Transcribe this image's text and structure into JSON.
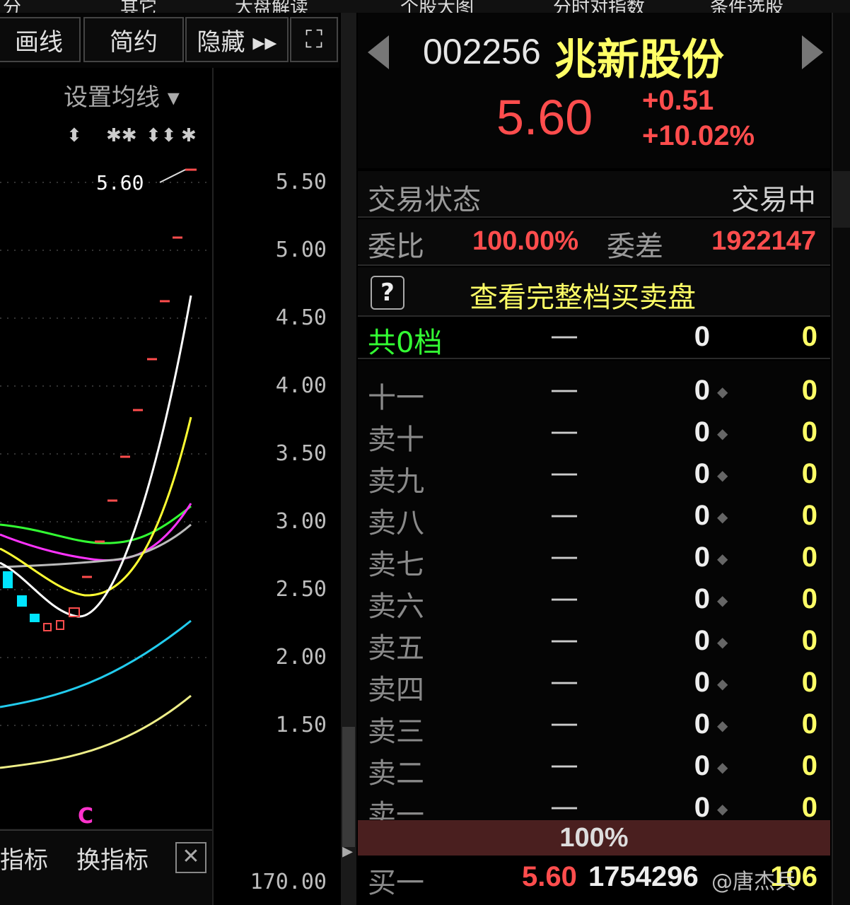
{
  "top_menu": [
    "分",
    "其它",
    "大盘解读",
    "个股大图",
    "分时对指数",
    "条件选股"
  ],
  "toolbar": {
    "draw_line": "画线",
    "simple": "简约",
    "hide": "隐藏 ▸▸",
    "fullscreen_icon": "⛶"
  },
  "chart": {
    "ma_setting": "设置均线 ▾",
    "price_marker": "5.60",
    "marker_c": "C",
    "axis_labels": [
      "5.50",
      "5.00",
      "4.50",
      "4.00",
      "3.50",
      "3.00",
      "2.50",
      "2.00",
      "1.50"
    ],
    "volume_axis_label": "170.00",
    "colors": {
      "up": "#ff4d4d",
      "down": "#00e5ff",
      "ma_white": "#ffffff",
      "ma_yellow": "#ffff33",
      "ma_magenta": "#ff33ff",
      "ma_green": "#33ff33",
      "ma_gray": "#bbbbbb",
      "ma_cyan": "#22ccee",
      "ma_pale_yellow": "#eeee88"
    }
  },
  "bottom_tabs": {
    "tab1": "指标",
    "tab2": "换指标",
    "close": "✕"
  },
  "quote": {
    "code": "002256",
    "name": "兆新股份",
    "price": "5.60",
    "change": "+0.51",
    "change_pct": "+10.02%"
  },
  "status": {
    "label": "交易状态",
    "value": "交易中"
  },
  "ratio": {
    "label": "委比",
    "value": "100.00%",
    "diff_label": "委差",
    "diff_value": "1922147"
  },
  "full_book": {
    "help": "?",
    "link": "查看完整档买卖盘"
  },
  "summary": {
    "label": "共0档",
    "dash": "—",
    "a": "0",
    "b": "0"
  },
  "levels": [
    {
      "name": "十一",
      "dash": "—",
      "a": "0",
      "b": "0"
    },
    {
      "name": "卖十",
      "dash": "—",
      "a": "0",
      "b": "0"
    },
    {
      "name": "卖九",
      "dash": "—",
      "a": "0",
      "b": "0"
    },
    {
      "name": "卖八",
      "dash": "—",
      "a": "0",
      "b": "0"
    },
    {
      "name": "卖七",
      "dash": "—",
      "a": "0",
      "b": "0"
    },
    {
      "name": "卖六",
      "dash": "—",
      "a": "0",
      "b": "0"
    },
    {
      "name": "卖五",
      "dash": "—",
      "a": "0",
      "b": "0"
    },
    {
      "name": "卖四",
      "dash": "—",
      "a": "0",
      "b": "0"
    },
    {
      "name": "卖三",
      "dash": "—",
      "a": "0",
      "b": "0"
    },
    {
      "name": "卖二",
      "dash": "—",
      "a": "0",
      "b": "0"
    },
    {
      "name": "卖一",
      "dash": "—",
      "a": "0",
      "b": "0"
    }
  ],
  "pct_bar": "100%",
  "buy1": {
    "label": "买一",
    "price": "5.60",
    "volume": "1754296",
    "count": "106"
  },
  "watermark": "@唐杰兵"
}
